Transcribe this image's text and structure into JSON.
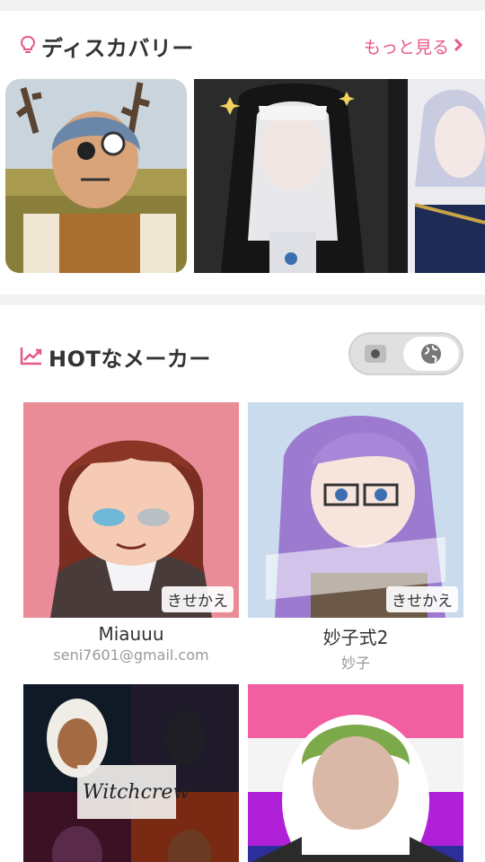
{
  "discovery": {
    "title": "ディスカバリー",
    "more_label": "もっと見る",
    "icon": "lightbulb-icon",
    "accent": "#e6578a"
  },
  "hot_makers": {
    "title": "HOTなメーカー",
    "icon": "trending-up-icon",
    "toggle": {
      "left": "image-icon",
      "right": "globe-icon",
      "selected": "right"
    },
    "items": [
      {
        "name": "Miauuu",
        "author": "seni7601@gmail.com",
        "badge": "きせかえ"
      },
      {
        "name": "妙子式2",
        "author": "妙子",
        "badge": "きせかえ"
      },
      {
        "name": "",
        "author": "",
        "badge": "",
        "overlay_text": "Witchcrew"
      },
      {
        "name": "",
        "author": "",
        "badge": ""
      }
    ]
  }
}
